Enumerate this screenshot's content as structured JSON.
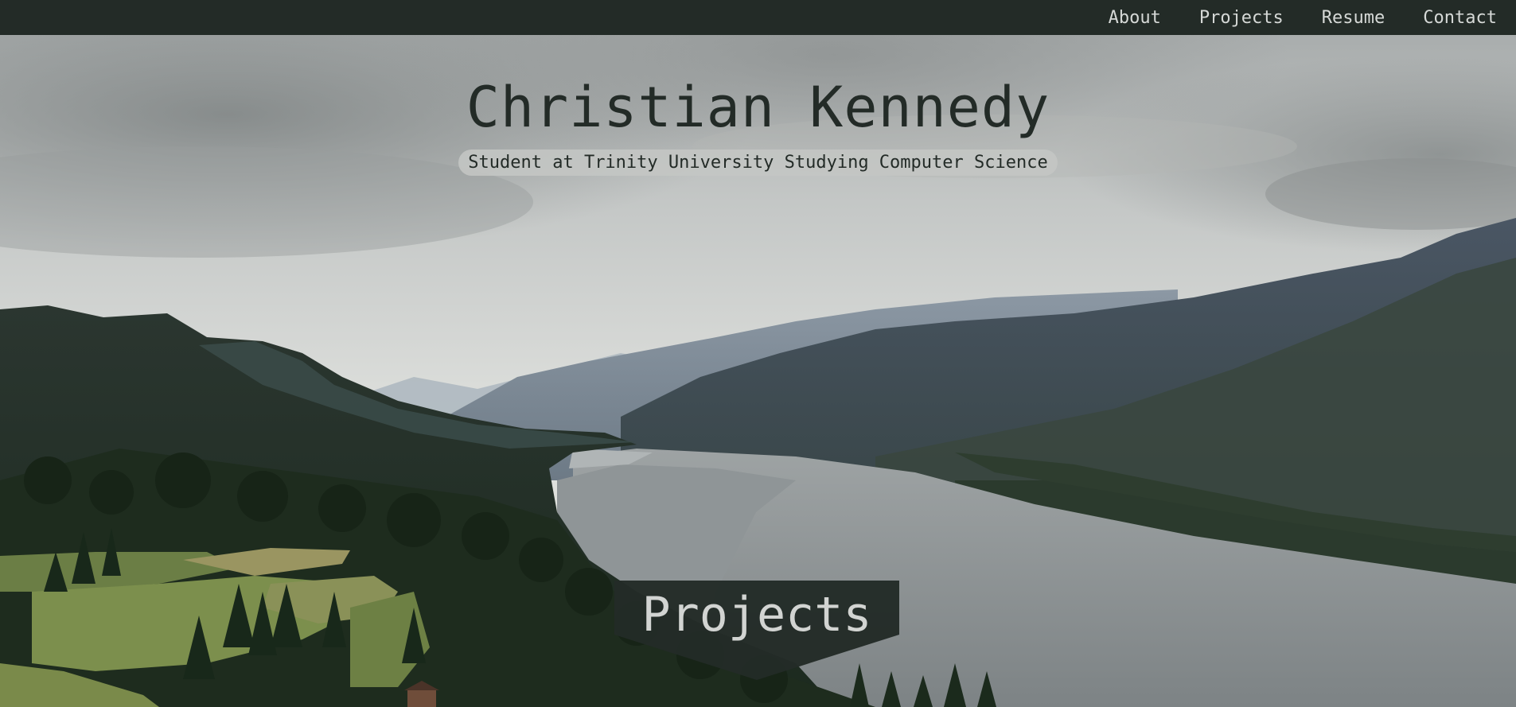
{
  "nav": {
    "items": [
      {
        "label": "About"
      },
      {
        "label": "Projects"
      },
      {
        "label": "Resume"
      },
      {
        "label": "Contact"
      }
    ]
  },
  "hero": {
    "title": "Christian Kennedy",
    "subtitle": "Student at Trinity University Studying Computer Science"
  },
  "projects_section": {
    "label": "Projects"
  },
  "colors": {
    "nav_bg": "#232b27",
    "nav_text": "#d6d9d7",
    "title_text": "#232b27",
    "banner_bg": "#232b27",
    "banner_text": "#d2d4d2"
  }
}
